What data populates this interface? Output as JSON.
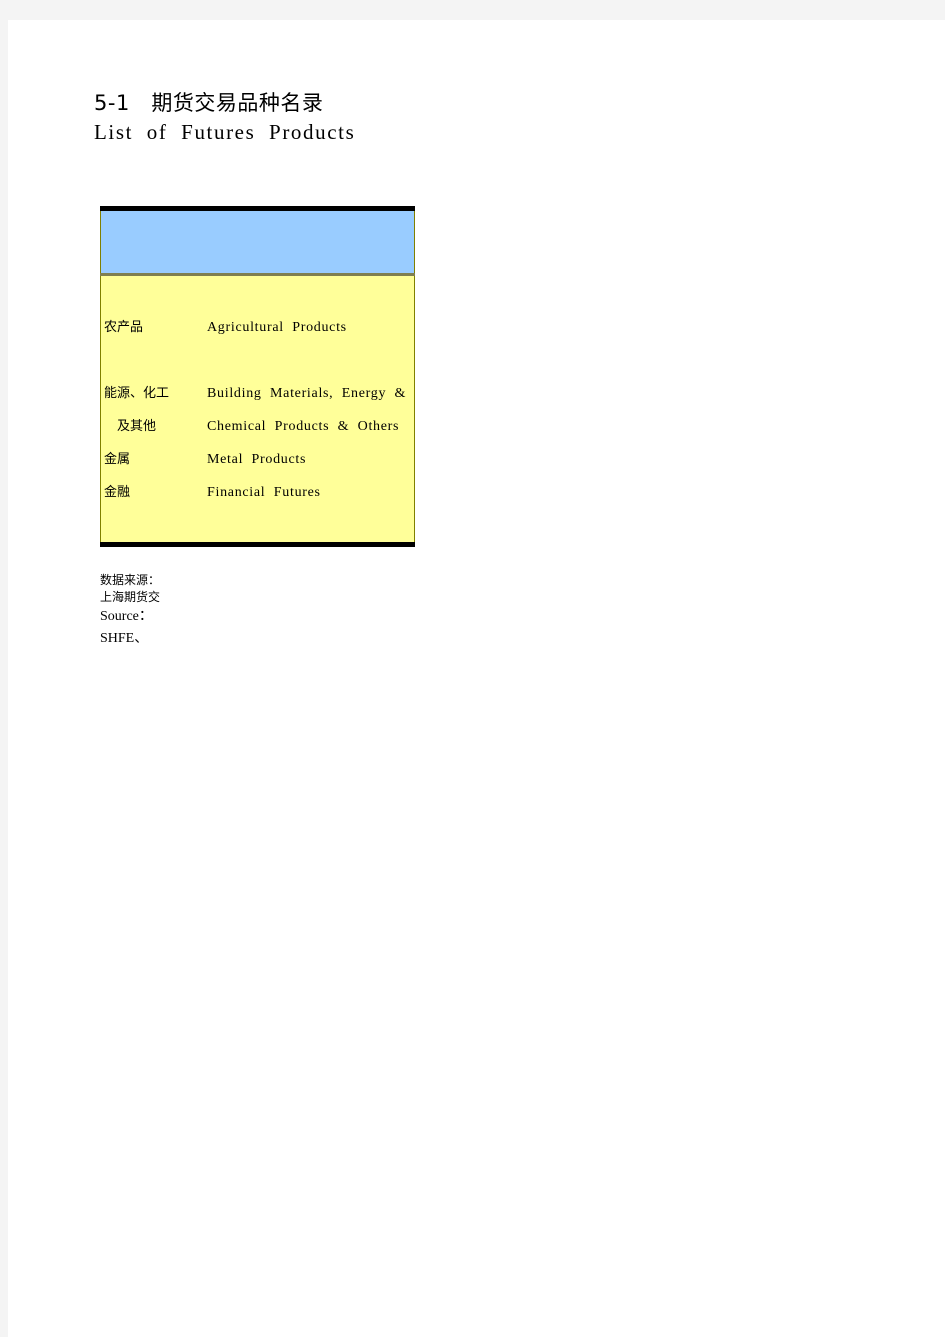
{
  "title": {
    "number": "5-1",
    "cn": "5-1   期货交易品种名录",
    "en": "List  of  Futures  Products"
  },
  "table": {
    "header": {
      "label": ""
    },
    "rows": [
      {
        "cn": "农产品",
        "en": "Agricultural  Products",
        "indent": false
      },
      {
        "cn": "能源、化工",
        "en": "Building  Materials,  Energy  &",
        "indent": false
      },
      {
        "cn": "及其他",
        "en": "Chemical  Products  &  Others",
        "indent": true
      },
      {
        "cn": "金属",
        "en": "Metal  Products",
        "indent": false
      },
      {
        "cn": "金融",
        "en": "Financial  Futures",
        "indent": false
      }
    ]
  },
  "source": {
    "cn_label": "数据来源：",
    "cn_value": "上海期货交",
    "en_label": "Source：",
    "en_value": "SHFE、"
  },
  "colors": {
    "header_bg": "#99ccff",
    "body_bg": "#ffff99",
    "rule": "#000000",
    "border": "#808000",
    "page_bg": "#ffffff",
    "canvas_bg": "#f4f4f4"
  }
}
